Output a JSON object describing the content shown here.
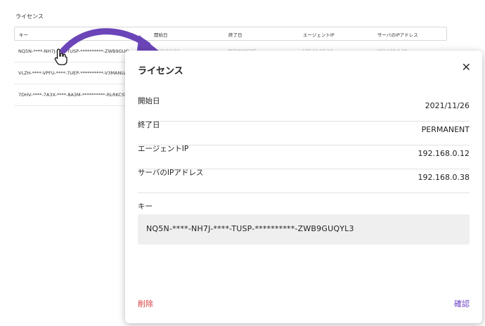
{
  "background": {
    "title": "ライセンス",
    "headers": [
      "キー",
      "開始日",
      "終了日",
      "エージェントIP",
      "サーバのIPアドレス"
    ],
    "rows": [
      {
        "key": "NQ5N-****-NH7J-****-TUSP-**********-ZWB9GUQ",
        "start": "2021/11/26",
        "end": "PERMANENT",
        "agent_ip": "172.16.50.10",
        "server_ip": "192.168.0.38"
      },
      {
        "key": "VLZH-****-VPFU-****-7UEP-**********-V3MANLV"
      },
      {
        "key": "7DHV-****-7A3X-****-8A3M-**********-RLRKCSV"
      }
    ]
  },
  "modal": {
    "title": "ライセンス",
    "fields": [
      {
        "label": "開始日",
        "value": "2021/11/26"
      },
      {
        "label": "終了日",
        "value": "PERMANENT"
      },
      {
        "label": "エージェントIP",
        "value": "192.168.0.12"
      },
      {
        "label": "サーバのIPアドレス",
        "value": "192.168.0.38"
      }
    ],
    "key_label": "キー",
    "key_value": "NQ5N-****-NH7J-****-TUSP-**********-ZWB9GUQYL3",
    "delete_label": "削除",
    "confirm_label": "確認",
    "close_icon": "close-icon"
  },
  "colors": {
    "delete": "#d64040",
    "confirm": "#6a3fc6",
    "arrow": "#6b45b8"
  }
}
